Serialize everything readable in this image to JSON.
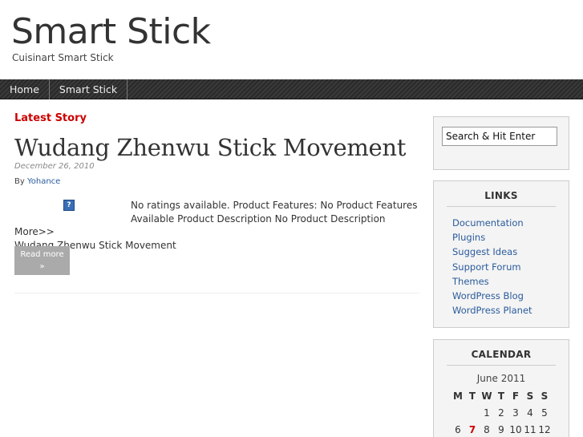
{
  "header": {
    "title": "Smart Stick",
    "description": "Cuisinart Smart Stick"
  },
  "nav": {
    "items": [
      {
        "label": "Home"
      },
      {
        "label": "Smart Stick"
      }
    ]
  },
  "main": {
    "section_label": "Latest Story",
    "post": {
      "title": "Wudang Zhenwu Stick Movement",
      "date": "December 26, 2010",
      "by_label": "By",
      "author": "Yohance",
      "image_icon": "broken-image-icon",
      "excerpt_line1": "No ratings available.   Product Features: No Product Features",
      "excerpt_line2": "Available Product Description No Product Description More>>",
      "excerpt_line3": "Wudang Zhenwu Stick Movement",
      "read_more": "Read more",
      "read_more_arrow": "»"
    }
  },
  "sidebar": {
    "search": {
      "value": "Search & Hit Enter"
    },
    "links": {
      "title": "LINKS",
      "items": [
        {
          "label": "Documentation"
        },
        {
          "label": "Plugins"
        },
        {
          "label": "Suggest Ideas"
        },
        {
          "label": "Support Forum"
        },
        {
          "label": "Themes"
        },
        {
          "label": "WordPress Blog"
        },
        {
          "label": "WordPress Planet"
        }
      ]
    },
    "calendar": {
      "title": "CALENDAR",
      "caption": "June 2011",
      "days": [
        "M",
        "T",
        "W",
        "T",
        "F",
        "S",
        "S"
      ],
      "week1": [
        "",
        "",
        "1",
        "2",
        "3",
        "4",
        "5"
      ],
      "week2": [
        "6",
        "7",
        "8",
        "9",
        "10",
        "11",
        "12"
      ]
    }
  },
  "colors": {
    "accent_red": "#cc0000",
    "link_blue": "#2a5b9c",
    "nav_bg": "#2a2a2a"
  }
}
